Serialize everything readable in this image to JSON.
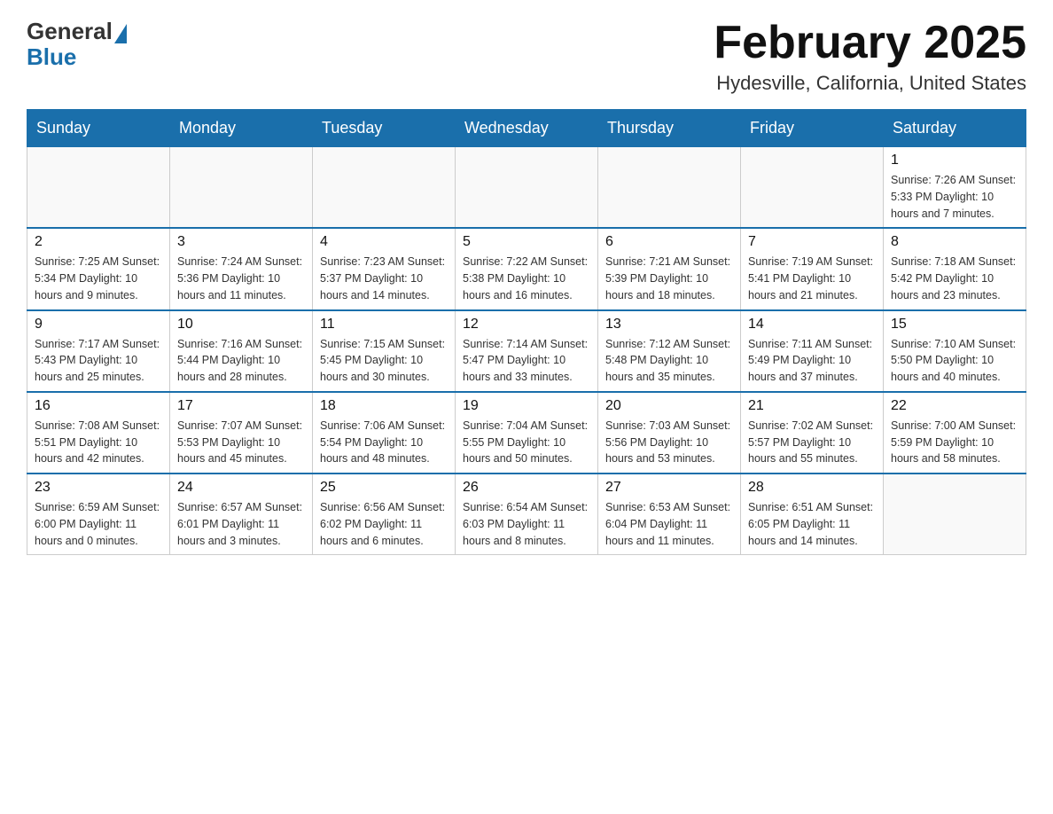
{
  "header": {
    "logo_general": "General",
    "logo_blue": "Blue",
    "month_title": "February 2025",
    "location": "Hydesville, California, United States"
  },
  "days_of_week": [
    "Sunday",
    "Monday",
    "Tuesday",
    "Wednesday",
    "Thursday",
    "Friday",
    "Saturday"
  ],
  "weeks": [
    [
      {
        "day": "",
        "info": ""
      },
      {
        "day": "",
        "info": ""
      },
      {
        "day": "",
        "info": ""
      },
      {
        "day": "",
        "info": ""
      },
      {
        "day": "",
        "info": ""
      },
      {
        "day": "",
        "info": ""
      },
      {
        "day": "1",
        "info": "Sunrise: 7:26 AM\nSunset: 5:33 PM\nDaylight: 10 hours and 7 minutes."
      }
    ],
    [
      {
        "day": "2",
        "info": "Sunrise: 7:25 AM\nSunset: 5:34 PM\nDaylight: 10 hours and 9 minutes."
      },
      {
        "day": "3",
        "info": "Sunrise: 7:24 AM\nSunset: 5:36 PM\nDaylight: 10 hours and 11 minutes."
      },
      {
        "day": "4",
        "info": "Sunrise: 7:23 AM\nSunset: 5:37 PM\nDaylight: 10 hours and 14 minutes."
      },
      {
        "day": "5",
        "info": "Sunrise: 7:22 AM\nSunset: 5:38 PM\nDaylight: 10 hours and 16 minutes."
      },
      {
        "day": "6",
        "info": "Sunrise: 7:21 AM\nSunset: 5:39 PM\nDaylight: 10 hours and 18 minutes."
      },
      {
        "day": "7",
        "info": "Sunrise: 7:19 AM\nSunset: 5:41 PM\nDaylight: 10 hours and 21 minutes."
      },
      {
        "day": "8",
        "info": "Sunrise: 7:18 AM\nSunset: 5:42 PM\nDaylight: 10 hours and 23 minutes."
      }
    ],
    [
      {
        "day": "9",
        "info": "Sunrise: 7:17 AM\nSunset: 5:43 PM\nDaylight: 10 hours and 25 minutes."
      },
      {
        "day": "10",
        "info": "Sunrise: 7:16 AM\nSunset: 5:44 PM\nDaylight: 10 hours and 28 minutes."
      },
      {
        "day": "11",
        "info": "Sunrise: 7:15 AM\nSunset: 5:45 PM\nDaylight: 10 hours and 30 minutes."
      },
      {
        "day": "12",
        "info": "Sunrise: 7:14 AM\nSunset: 5:47 PM\nDaylight: 10 hours and 33 minutes."
      },
      {
        "day": "13",
        "info": "Sunrise: 7:12 AM\nSunset: 5:48 PM\nDaylight: 10 hours and 35 minutes."
      },
      {
        "day": "14",
        "info": "Sunrise: 7:11 AM\nSunset: 5:49 PM\nDaylight: 10 hours and 37 minutes."
      },
      {
        "day": "15",
        "info": "Sunrise: 7:10 AM\nSunset: 5:50 PM\nDaylight: 10 hours and 40 minutes."
      }
    ],
    [
      {
        "day": "16",
        "info": "Sunrise: 7:08 AM\nSunset: 5:51 PM\nDaylight: 10 hours and 42 minutes."
      },
      {
        "day": "17",
        "info": "Sunrise: 7:07 AM\nSunset: 5:53 PM\nDaylight: 10 hours and 45 minutes."
      },
      {
        "day": "18",
        "info": "Sunrise: 7:06 AM\nSunset: 5:54 PM\nDaylight: 10 hours and 48 minutes."
      },
      {
        "day": "19",
        "info": "Sunrise: 7:04 AM\nSunset: 5:55 PM\nDaylight: 10 hours and 50 minutes."
      },
      {
        "day": "20",
        "info": "Sunrise: 7:03 AM\nSunset: 5:56 PM\nDaylight: 10 hours and 53 minutes."
      },
      {
        "day": "21",
        "info": "Sunrise: 7:02 AM\nSunset: 5:57 PM\nDaylight: 10 hours and 55 minutes."
      },
      {
        "day": "22",
        "info": "Sunrise: 7:00 AM\nSunset: 5:59 PM\nDaylight: 10 hours and 58 minutes."
      }
    ],
    [
      {
        "day": "23",
        "info": "Sunrise: 6:59 AM\nSunset: 6:00 PM\nDaylight: 11 hours and 0 minutes."
      },
      {
        "day": "24",
        "info": "Sunrise: 6:57 AM\nSunset: 6:01 PM\nDaylight: 11 hours and 3 minutes."
      },
      {
        "day": "25",
        "info": "Sunrise: 6:56 AM\nSunset: 6:02 PM\nDaylight: 11 hours and 6 minutes."
      },
      {
        "day": "26",
        "info": "Sunrise: 6:54 AM\nSunset: 6:03 PM\nDaylight: 11 hours and 8 minutes."
      },
      {
        "day": "27",
        "info": "Sunrise: 6:53 AM\nSunset: 6:04 PM\nDaylight: 11 hours and 11 minutes."
      },
      {
        "day": "28",
        "info": "Sunrise: 6:51 AM\nSunset: 6:05 PM\nDaylight: 11 hours and 14 minutes."
      },
      {
        "day": "",
        "info": ""
      }
    ]
  ]
}
